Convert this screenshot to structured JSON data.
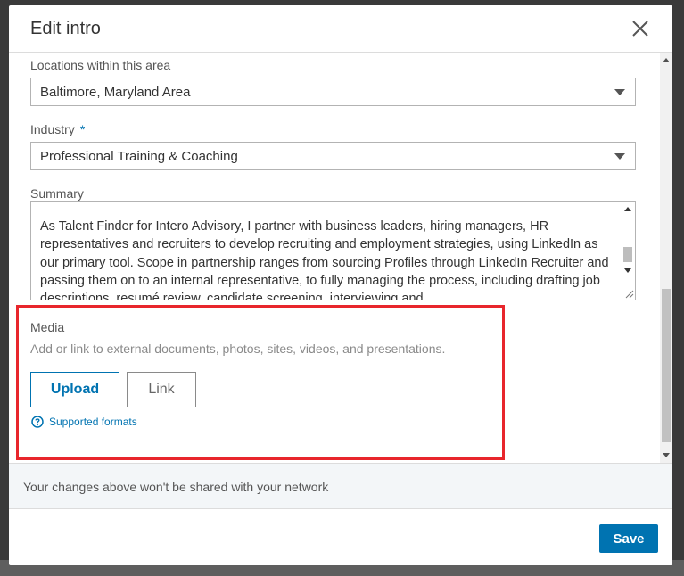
{
  "modal": {
    "title": "Edit intro",
    "close_icon": "close-icon"
  },
  "fields": {
    "locations": {
      "label": "Locations within this area",
      "value": "Baltimore, Maryland Area",
      "caret_icon": "chevron-down-icon"
    },
    "industry": {
      "label": "Industry",
      "required_marker": "*",
      "value": "Professional Training & Coaching",
      "caret_icon": "chevron-down-icon"
    },
    "summary": {
      "label": "Summary",
      "value": "As Talent Finder for Intero Advisory, I partner with business leaders, hiring managers, HR representatives and recruiters to develop recruiting and employment strategies, using LinkedIn as our primary tool. Scope in partnership ranges from sourcing Profiles through LinkedIn Recruiter and passing them on to an internal representative, to fully managing the process, including drafting job descriptions, resumé review, candidate screening, interviewing and"
    }
  },
  "media": {
    "label": "Media",
    "description": "Add or link to external documents, photos, sites, videos, and presentations.",
    "upload_label": "Upload",
    "link_label": "Link",
    "formats_label": "Supported formats",
    "formats_icon": "help-circle-icon",
    "highlight_color": "#e8262c"
  },
  "footer": {
    "notice": "Your changes above won't be shared with your network",
    "save_label": "Save"
  },
  "colors": {
    "primary": "#0073b1",
    "notice_bg": "#f3f6f8"
  }
}
